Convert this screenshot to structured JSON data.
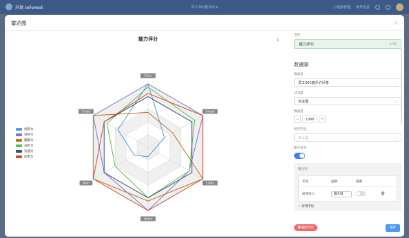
{
  "appbar": {
    "brand": "开发 infomat",
    "center_text": "员工360度评价 ▾",
    "right_items": [
      "小程序管理",
      "账号信息"
    ]
  },
  "modal": {
    "title": "雷达图",
    "close_icon": "close-icon"
  },
  "chart": {
    "title": "能力评分",
    "download_icon": "download-icon"
  },
  "settings": {
    "name_label": "名称",
    "name_value": "能力评分",
    "name_count": "4/48",
    "section_title": "数据源",
    "table_label": "数据表",
    "table_value": "员工360度评价问卷",
    "filter_label": "过滤器",
    "filter_value": "未设置",
    "count_label": "数据量",
    "count_value": "1000",
    "sort_label": "排序字段",
    "sort_value": "未设置",
    "aggregate_label": "聚合查询",
    "group_label": "聚合列",
    "col_field": "字段",
    "col_func": "函数",
    "col_hidden": "隐藏",
    "row_field": "被考核人",
    "row_func": "最大值",
    "add_field": "新增字段",
    "delete_button": "删除卡片",
    "save_button": "保存"
  },
  "colors": {
    "accent": "#3b82f6",
    "danger": "#f16b6b"
  },
  "chart_data": {
    "type": "radar",
    "title": "能力评分",
    "axes": [
      "Chris",
      "Angel",
      "Linda",
      "Helen",
      "Alan",
      "Cindy"
    ],
    "max": 100,
    "series": [
      {
        "name": "创新力",
        "color": "#5b9bd5",
        "values": [
          100,
          30,
          10,
          15,
          25,
          55
        ]
      },
      {
        "name": "领导力",
        "color": "#7b74d8",
        "values": [
          100,
          100,
          75,
          100,
          80,
          100
        ]
      },
      {
        "name": "理解力",
        "color": "#b8731d",
        "values": [
          55,
          45,
          100,
          85,
          100,
          100
        ]
      },
      {
        "name": "分析力",
        "color": "#5cbf4f",
        "values": [
          95,
          85,
          75,
          80,
          60,
          75
        ]
      },
      {
        "name": "沟通力",
        "color": "#3a4f7a",
        "values": [
          80,
          80,
          80,
          80,
          80,
          80
        ]
      },
      {
        "name": "应用力",
        "color": "#d14a2c",
        "values": [
          85,
          100,
          100,
          100,
          100,
          80
        ]
      }
    ]
  }
}
